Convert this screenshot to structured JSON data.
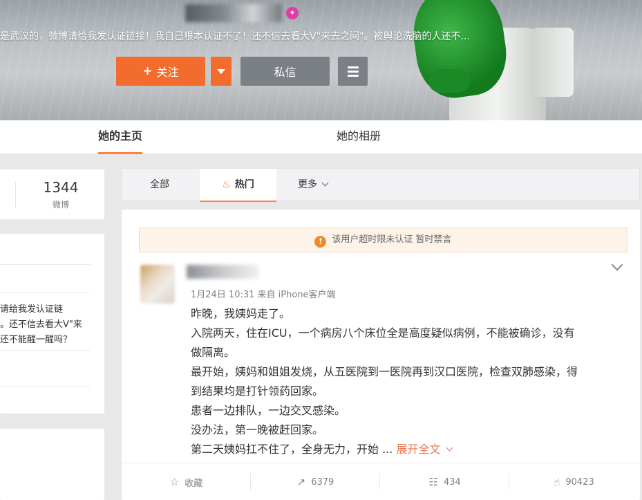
{
  "banner": {
    "verified_badge": "✦",
    "bio": "是武汉的，微博请给我发认证链接！我自己根本认证不了！还不信去看大V\"来去之间\"。被舆论洗脑的人还不...",
    "follow_plus": "+",
    "follow_label": "关注",
    "message_label": "私信"
  },
  "tabs": {
    "home": "她的主页",
    "album": "她的相册"
  },
  "sidebar": {
    "stat_value": "1344",
    "stat_label": "微博",
    "bio_lines": [
      "请给我发认证链",
      "。还不信去看大V\"来",
      "还不能醒一醒吗？"
    ]
  },
  "filter": {
    "all": "全部",
    "hot": "热门",
    "more": "更多"
  },
  "post": {
    "notice": "该用户超时限未认证 暂时禁言",
    "meta": "1月24日 10:31 来自 iPhone客户端",
    "lines": [
      "昨晚，我姨妈走了。",
      "入院两天，住在ICU，一个病房八个床位全是高度疑似病例，不能被确诊，没有",
      "做隔离。",
      "最开始，姨妈和姐姐发烧，从五医院到一医院再到汉口医院，检查双肺感染，得",
      "到结果均是打针领药回家。",
      "患者一边排队，一边交叉感染。",
      "没办法，第一晚被赶回家。"
    ],
    "last_line": "第二天姨妈扛不住了，全身无力，开始 ... ",
    "expand": "展开全文",
    "actions": {
      "favorite": "收藏",
      "repost": "6379",
      "comment": "434",
      "like": "90423"
    }
  }
}
